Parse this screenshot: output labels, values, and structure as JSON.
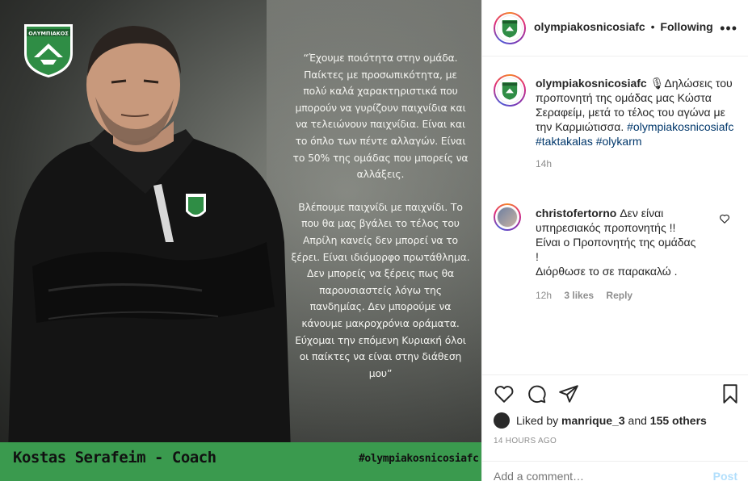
{
  "post": {
    "crest_text": "ΟΛΥΜΠΙΑΚΟΣ",
    "quote_paragraphs": [
      "“Έχουμε ποιότητα στην ομάδα. Παίκτες με προσωπικότητα, με πολύ καλά χαρακτηριστικά που μπορούν να γυρίζουν παιχνίδια και να τελειώνουν παιχνίδια. Είναι και το όπλο των πέντε αλλαγών. Είναι το 50% της ομάδας που μπορείς να αλλάξεις.",
      "Βλέπουμε παιχνίδι με παιχνίδι. Το που θα μας βγάλει το τέλος του Απρίλη κανείς δεν μπορεί να το ξέρει. Είναι ιδιόμορφο πρωτάθλημα. Δεν μπορείς να ξέρεις πως θα παρουσιαστείς λόγω της πανδημίας. Δεν μπορούμε να κάνουμε μακροχρόνια οράματα. Εύχομαι την επόμενη Κυριακή όλοι οι παίκτες να είναι στην διάθεση μου”"
    ],
    "banner_name": "Kostas Serafeim - Coach",
    "banner_hashtag": "#olympiakosnicosiafc"
  },
  "header": {
    "username": "olympiakosnicosiafc",
    "separator": "•",
    "follow_status": "Following",
    "more_label": "•••"
  },
  "caption": {
    "username": "olympiakosnicosiafc",
    "mic_emoji": "🎙",
    "text": "Δηλώσεις του προπονητή της ομάδας μας Κώστα Σεραφείμ, μετά το τέλος του αγώνα με την Καρμιώτισσα.",
    "hashtags": [
      "#olympiakosnicosiafc",
      "#taktakalas",
      "#olykarm"
    ],
    "time": "14h"
  },
  "comment": {
    "username": "christofertorno",
    "line1": "Δεν είναι υπηρεσιακός προπονητής !!",
    "line2": "Είναι ο Προπονητής της ομάδας",
    "line3": "!",
    "line4": "Διόρθωσε το σε παρακαλώ .",
    "time": "12h",
    "likes": "3 likes",
    "reply": "Reply"
  },
  "actions": {
    "liked_prefix": "Liked by",
    "liker": "manrique_3",
    "and": "and",
    "others": "155 others",
    "posted": "14 HOURS AGO",
    "add_placeholder": "Add a comment…",
    "post_label": "Post"
  },
  "colors": {
    "banner_green": "#3a9a4e",
    "hashtag_blue": "#00376b",
    "post_button_disabled": "#b2dffc"
  }
}
